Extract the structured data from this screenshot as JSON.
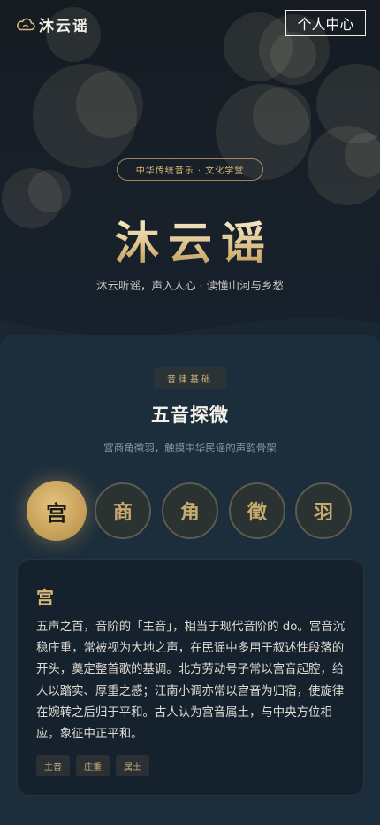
{
  "header": {
    "brand": "沐云谣",
    "logo_icon": "cloud-icon",
    "profile_label": "个人中心"
  },
  "hero": {
    "badge": "中华传统音乐 · 文化学堂",
    "title": "沐云谣",
    "subtitle": "沐云听谣，声入人心 · 读懂山河与乡愁"
  },
  "section": {
    "tag": "音律基础",
    "title": "五音探微",
    "subtitle": "宫商角徵羽，触摸中华民谣的声韵骨架"
  },
  "tones": [
    {
      "label": "宫",
      "active": true
    },
    {
      "label": "商",
      "active": false
    },
    {
      "label": "角",
      "active": false
    },
    {
      "label": "徵",
      "active": false
    },
    {
      "label": "羽",
      "active": false
    }
  ],
  "detail": {
    "title": "宫",
    "body": "五声之首，音阶的「主音」，相当于现代音阶的 do。宫音沉稳庄重，常被视为大地之声，在民谣中多用于叙述性段落的开头，奠定整首歌的基调。北方劳动号子常以宫音起腔，给人以踏实、厚重之感；江南小调亦常以宫音为归宿，使旋律在婉转之后归于平和。古人认为宫音属土，与中央方位相应，象征中正平和。",
    "chips": [
      "主音",
      "庄重",
      "属土"
    ]
  },
  "colors": {
    "accent": "#d7b878",
    "background": "#1c2d3b",
    "active_tone": "#caa45d"
  }
}
